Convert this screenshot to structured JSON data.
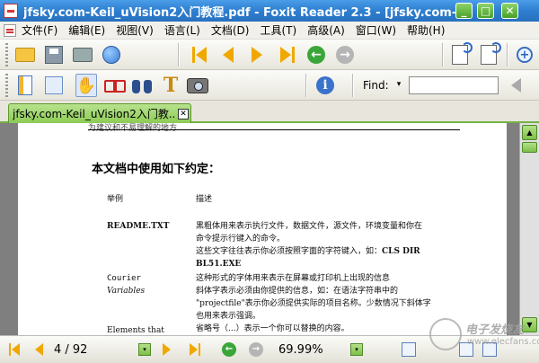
{
  "window": {
    "title": "jfsky.com-Keil_uVision2入门教程.pdf - Foxit Reader 2.3 - [jfsky.com-Keil_uVisio"
  },
  "menu": [
    "文件(F)",
    "编辑(E)",
    "视图(V)",
    "语言(L)",
    "文档(D)",
    "工具(T)",
    "高级(A)",
    "窗口(W)",
    "帮助(H)"
  ],
  "find": {
    "label": "Find:",
    "dropdown_glyph": "▾",
    "value": ""
  },
  "tab": {
    "label": "jfsky.com-Keil_uVision2入门教...",
    "close_glyph": "✕"
  },
  "document": {
    "cut_text": "为建议和不易理解的地方",
    "heading": "本文档中使用如下约定：",
    "column_headers": [
      "举例",
      "描述"
    ],
    "rows": [
      {
        "example": "README.TXT",
        "desc": [
          "黑粗体用来表示执行文件，数据文件，源文件，环境变量和你在",
          "命令提示行键入的命令。",
          "这些文字往往表示你必须按照字面的字符键入，如：",
          "BL51.EXE"
        ],
        "desc_bold_tail": "CLS DIR"
      },
      {
        "example": "Courier",
        "desc": [
          "这种形式的字体用来表示在屏幕或打印机上出现的信息"
        ]
      },
      {
        "example": "Variables",
        "desc": [
          "斜体字表示必须由你提供的信息，如：在语法字符串中的",
          "\"projectfile\"表示你必须提供实际的项目名称。少数情况下斜体字",
          "也用来表示强调。"
        ],
        "desc_italic": "projectfile"
      },
      {
        "example": "Elements that",
        "desc": [
          "省略号（...）表示一个你可以替换的内容。"
        ]
      }
    ]
  },
  "status": {
    "page_indicator": "4 / 92",
    "zoom": "69.99%",
    "dropdown_glyph": "▾"
  },
  "watermark": {
    "line1": "电子发烧友",
    "line2": "www.elecfans.com"
  },
  "colors": {
    "titlebar": "#2e7fd0",
    "accent_green": "#7cbf48",
    "nav_arrow": "#f0a800",
    "doc_background": "#7f7f7f"
  }
}
